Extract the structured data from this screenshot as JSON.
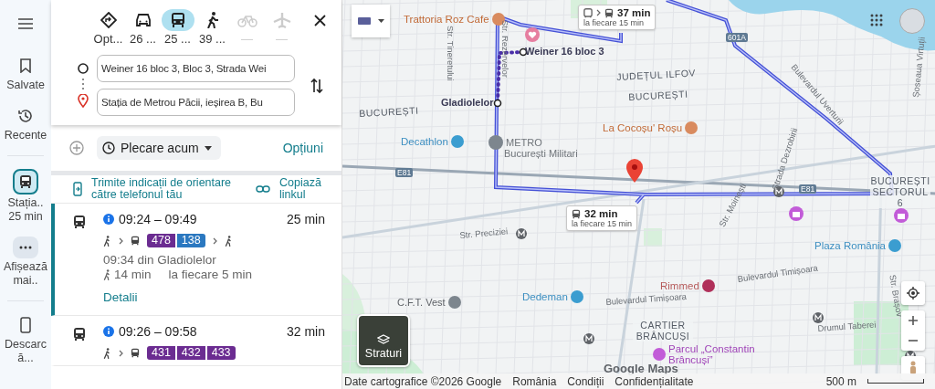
{
  "rail": [
    {
      "kind": "saved",
      "label": "Salvate",
      "selected": false
    },
    {
      "kind": "recent",
      "label": "Recente",
      "selected": false
    },
    {
      "kind": "trip",
      "label": "Stația..",
      "sublabel": "25 min",
      "selected": true
    },
    {
      "kind": "more",
      "label": "Afișează mai..",
      "selected": false
    },
    {
      "kind": "download",
      "label": "Descarcă...",
      "selected": false
    }
  ],
  "modes": [
    {
      "kind": "best",
      "label": "Opt...",
      "selected": false,
      "disabled": false
    },
    {
      "kind": "car",
      "label": "26 ...",
      "selected": false,
      "disabled": false
    },
    {
      "kind": "transit",
      "label": "25 ...",
      "selected": true,
      "disabled": false
    },
    {
      "kind": "walk",
      "label": "39 ...",
      "selected": false,
      "disabled": false
    },
    {
      "kind": "bike",
      "label": "—",
      "selected": false,
      "disabled": true
    },
    {
      "kind": "flight",
      "label": "—",
      "selected": false,
      "disabled": true
    }
  ],
  "origin": {
    "value": "Weiner 16 bloc 3, Bloc 3, Strada Wei"
  },
  "destination": {
    "value": "Stația de Metrou Păcii, ieșirea B, Bu"
  },
  "depart": "Plecare acum",
  "options": "Opțiuni",
  "send_to_phone": "Trimite indicații de orientare către telefonul tău",
  "copy_link": "Copiază linkul",
  "routes": [
    {
      "selected": true,
      "time": "09:24 – 09:49",
      "duration": "25 min",
      "lines": [
        {
          "label": "478",
          "color": "#6b2c91"
        },
        {
          "label": "138",
          "color": "#2b78c0"
        }
      ],
      "walk_end": true,
      "departure": "09:34 din Gladiolelor",
      "walk": "14 min",
      "frequency": "la fiecare 5 min",
      "details": "Detalii"
    },
    {
      "selected": false,
      "time": "09:26 – 09:58",
      "duration": "32 min",
      "lines": [
        {
          "label": "431",
          "color": "#6b2c91"
        },
        {
          "label": "432",
          "color": "#6b2c91"
        },
        {
          "label": "433",
          "color": "#6b2c91"
        }
      ],
      "walk_end": false
    }
  ],
  "map": {
    "labels": [
      {
        "text": "Trattoria Roz Cafe",
        "kind": "food"
      },
      {
        "text": "Weiner 16 bloc 3",
        "kind": "stop"
      },
      {
        "text": "Str. Tineretului",
        "kind": "street"
      },
      {
        "text": "Str. Rezervelor",
        "kind": "street"
      },
      {
        "text": "JUDEȚUL ILFOV",
        "kind": "area"
      },
      {
        "text": "BUCUREȘTI",
        "kind": "area"
      },
      {
        "text": "Gladiolelor",
        "kind": "stop"
      },
      {
        "text": "BUCUREȘTI",
        "kind": "area"
      },
      {
        "text": "Decathlon",
        "kind": "shop"
      },
      {
        "text": "METRO",
        "kind": "transit"
      },
      {
        "text": "București Militari",
        "kind": "place"
      },
      {
        "text": "La Cocoșu' Roșu",
        "kind": "food"
      },
      {
        "text": "Bulevardul Uverturii",
        "kind": "street"
      },
      {
        "text": "Strada Dezrobirii",
        "kind": "street"
      },
      {
        "text": "Șoseaua Virtuții",
        "kind": "street"
      },
      {
        "text": "BUCUREȘTI SECTORUL 6",
        "kind": "area"
      },
      {
        "text": "Str. Preciziei",
        "kind": "street"
      },
      {
        "text": "Str. Moinești",
        "kind": "street"
      },
      {
        "text": "Plaza România",
        "kind": "shop"
      },
      {
        "text": "Rimmed",
        "kind": "hospital"
      },
      {
        "text": "Bulevardul Timișoara",
        "kind": "street"
      },
      {
        "text": "Dedeman",
        "kind": "shop"
      },
      {
        "text": "Bulevardul Timișoara",
        "kind": "street"
      },
      {
        "text": "C.F.T. Vest",
        "kind": "landmark"
      },
      {
        "text": "CARTIER BRÂNCUȘI",
        "kind": "area"
      },
      {
        "text": "Drumul Taberei",
        "kind": "street"
      },
      {
        "text": "Str. Brașov",
        "kind": "street"
      },
      {
        "text": "Parcul „Constantin Brâncuși”",
        "kind": "park"
      },
      {
        "text": "601A",
        "kind": "shield"
      },
      {
        "text": "E81",
        "kind": "shield"
      },
      {
        "text": "E81",
        "kind": "shield"
      }
    ],
    "callouts": [
      {
        "duration": "37 min",
        "frequency": "la fiecare 15 min",
        "walk_first": true
      },
      {
        "duration": "32 min",
        "frequency": "la fiecare 15 min",
        "walk_first": false
      }
    ],
    "layers": "Straturi",
    "logo": "Google Maps",
    "footer": [
      "Date cartografice ©2026 Google",
      "România",
      "Condiții",
      "Confidențialitate"
    ],
    "scale": "500 m"
  }
}
